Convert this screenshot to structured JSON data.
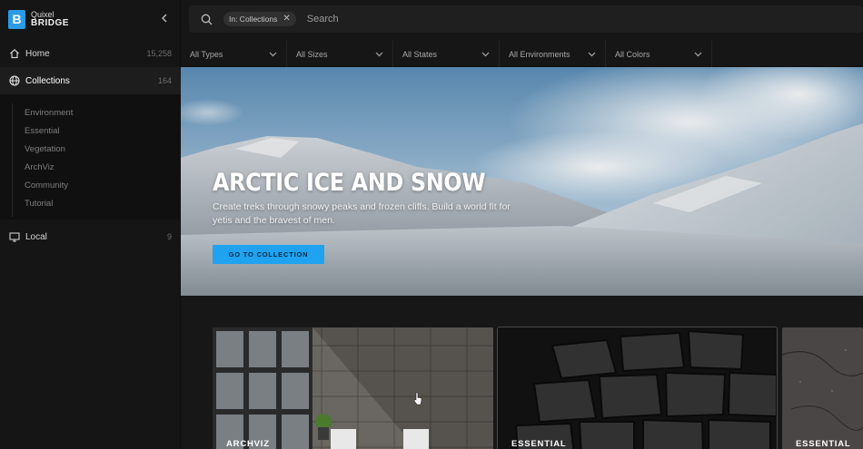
{
  "brand": {
    "line1": "Quixel",
    "line2": "BRIDGE",
    "badge": "B",
    "color": "#2a9be8"
  },
  "sidebar": {
    "items": [
      {
        "label": "Home",
        "count": "15,258",
        "icon": "home-icon"
      },
      {
        "label": "Collections",
        "count": "164",
        "icon": "globe-icon",
        "active": true
      },
      {
        "label": "Local",
        "count": "9",
        "icon": "monitor-icon"
      }
    ],
    "collections": [
      "Environment",
      "Essential",
      "Vegetation",
      "ArchViz",
      "Community",
      "Tutorial"
    ]
  },
  "search": {
    "chip": "In: Collections",
    "placeholder": "Search"
  },
  "filters": [
    "All Types",
    "All Sizes",
    "All States",
    "All Environments",
    "All Colors"
  ],
  "hero": {
    "title": "ARCTIC ICE AND SNOW",
    "description": "Create treks through snowy peaks and frozen cliffs. Build a world fit for yetis and the bravest of men.",
    "button": "GO TO COLLECTION",
    "accent": "#1fa2ef"
  },
  "cards": [
    {
      "label": "ARCHVIZ"
    },
    {
      "label": "ESSENTIAL"
    },
    {
      "label": "ESSENTIAL"
    }
  ]
}
